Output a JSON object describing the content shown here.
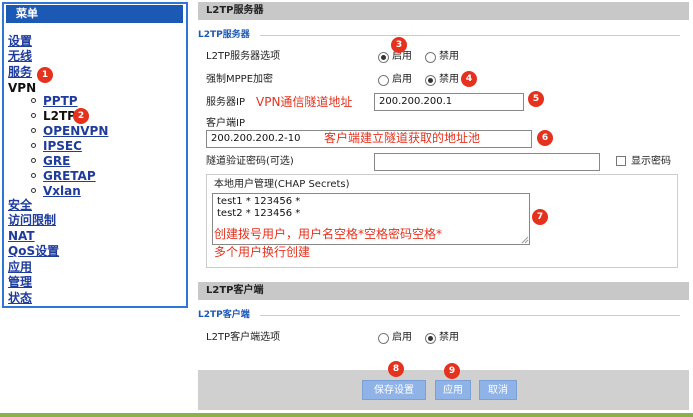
{
  "sidebar": {
    "title": "菜单",
    "items": [
      {
        "label": "设置"
      },
      {
        "label": "无线"
      },
      {
        "label": "服务"
      },
      {
        "label": "VPN"
      },
      {
        "label": "安全"
      },
      {
        "label": "访问限制"
      },
      {
        "label": "NAT"
      },
      {
        "label": "QoS设置"
      },
      {
        "label": "应用"
      },
      {
        "label": "管理"
      },
      {
        "label": "状态"
      }
    ],
    "vpn_sub": [
      {
        "label": "PPTP"
      },
      {
        "label": "L2TP"
      },
      {
        "label": "OPENVPN"
      },
      {
        "label": "IPSEC"
      },
      {
        "label": "GRE"
      },
      {
        "label": "GRETAP"
      },
      {
        "label": "Vxlan"
      }
    ]
  },
  "server": {
    "header": "L2TP服务器",
    "group_title": "L2TP服务器",
    "option_label": "L2TP服务器选项",
    "enable_label": "启用",
    "disable_label": "禁用",
    "option_value": "启用",
    "mppe_label": "强制MPPE加密",
    "mppe_value": "禁用",
    "server_ip_label": "服务器IP",
    "server_ip_value": "200.200.200.1",
    "client_ip_label": "客户端IP",
    "client_ip_value": "200.200.200.2-10",
    "tunnel_pwd_label": "隧道验证密码(可选)",
    "tunnel_pwd_value": "",
    "show_pwd_label": "显示密码",
    "users_label": "本地用户管理(CHAP Secrets)",
    "users_value": "test1 * 123456 *\ntest2 * 123456 *"
  },
  "client": {
    "header": "L2TP客户端",
    "group_title": "L2TP客户端",
    "option_label": "L2TP客户端选项",
    "enable_label": "启用",
    "disable_label": "禁用",
    "option_value": "禁用"
  },
  "buttons": {
    "save": "保存设置",
    "apply": "应用",
    "cancel": "取消"
  },
  "annotations": {
    "server_ip": "VPN通信隧道地址",
    "client_ip": "客户端建立隧道获取的地址池",
    "users_line1": "创建拨号用户，用户名空格*空格密码空格*",
    "users_line2": "多个用户换行创建"
  },
  "markers": [
    "1",
    "2",
    "3",
    "4",
    "5",
    "6",
    "7",
    "8",
    "9"
  ],
  "colors": {
    "accent_blue": "#1c59b5",
    "link_blue": "#1f3c9c",
    "annotation_red": "#e4321e",
    "button_blue": "#8fb3e6",
    "header_gray": "#c8c8c8",
    "bottom_green": "#8cb04a"
  }
}
